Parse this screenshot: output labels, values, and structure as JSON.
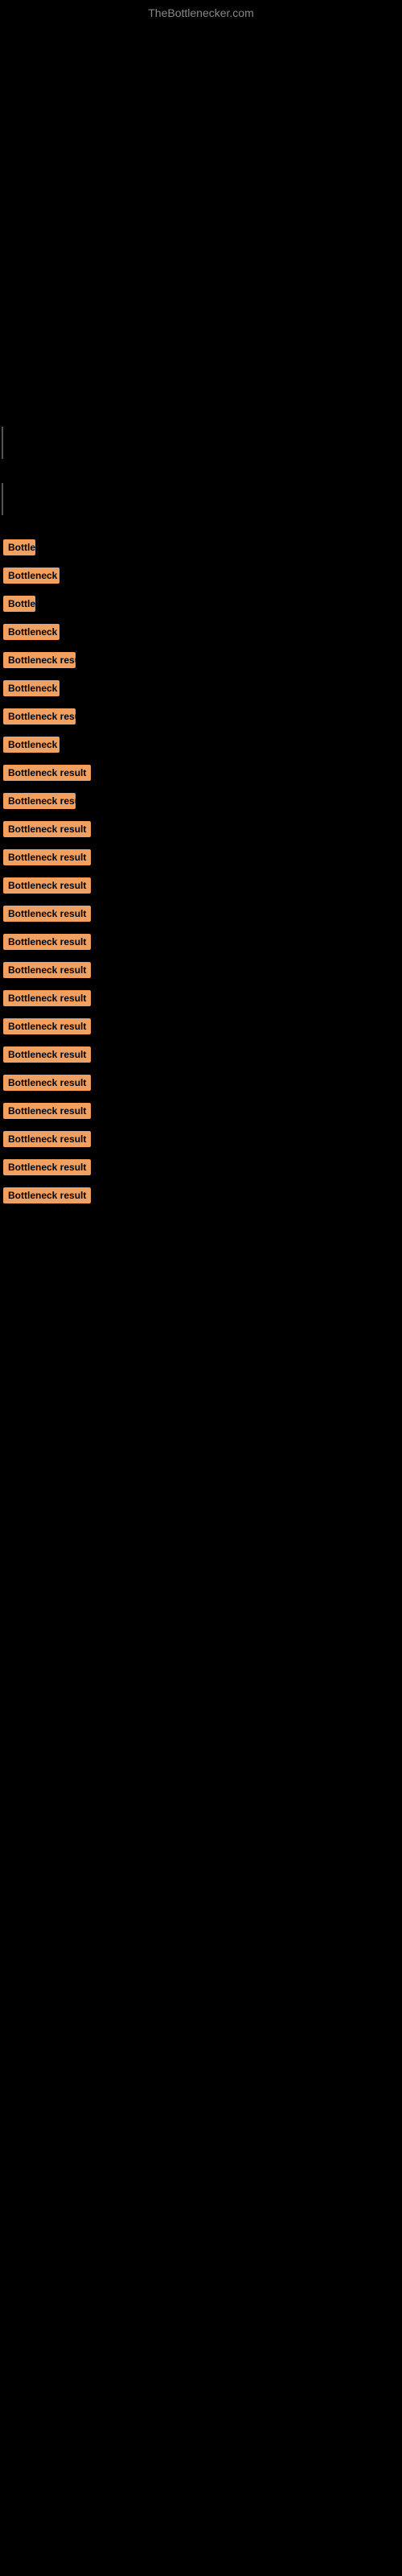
{
  "header": {
    "site_title": "TheBottlenecker.com"
  },
  "bottleneck_items": [
    {
      "id": 1,
      "label": "Bottleneck result",
      "badge_class": "badge-xs"
    },
    {
      "id": 2,
      "label": "Bottleneck result",
      "badge_class": "badge-sm"
    },
    {
      "id": 3,
      "label": "Bottleneck result",
      "badge_class": "badge-xs"
    },
    {
      "id": 4,
      "label": "Bottleneck result",
      "badge_class": "badge-sm"
    },
    {
      "id": 5,
      "label": "Bottleneck result",
      "badge_class": "badge-md"
    },
    {
      "id": 6,
      "label": "Bottleneck result",
      "badge_class": "badge-sm"
    },
    {
      "id": 7,
      "label": "Bottleneck result",
      "badge_class": "badge-md"
    },
    {
      "id": 8,
      "label": "Bottleneck result",
      "badge_class": "badge-sm"
    },
    {
      "id": 9,
      "label": "Bottleneck result",
      "badge_class": "badge-lg"
    },
    {
      "id": 10,
      "label": "Bottleneck result",
      "badge_class": "badge-md"
    },
    {
      "id": 11,
      "label": "Bottleneck result",
      "badge_class": "badge-xl"
    },
    {
      "id": 12,
      "label": "Bottleneck result",
      "badge_class": "badge-xl"
    },
    {
      "id": 13,
      "label": "Bottleneck result",
      "badge_class": "badge-xl"
    },
    {
      "id": 14,
      "label": "Bottleneck result",
      "badge_class": "badge-xl"
    },
    {
      "id": 15,
      "label": "Bottleneck result",
      "badge_class": "badge-xl"
    },
    {
      "id": 16,
      "label": "Bottleneck result",
      "badge_class": "badge-xl"
    },
    {
      "id": 17,
      "label": "Bottleneck result",
      "badge_class": "badge-xl"
    },
    {
      "id": 18,
      "label": "Bottleneck result",
      "badge_class": "badge-xl"
    },
    {
      "id": 19,
      "label": "Bottleneck result",
      "badge_class": "badge-xl"
    },
    {
      "id": 20,
      "label": "Bottleneck result",
      "badge_class": "badge-xl"
    },
    {
      "id": 21,
      "label": "Bottleneck result",
      "badge_class": "badge-xl"
    },
    {
      "id": 22,
      "label": "Bottleneck result",
      "badge_class": "badge-xl"
    },
    {
      "id": 23,
      "label": "Bottleneck result",
      "badge_class": "badge-xl"
    },
    {
      "id": 24,
      "label": "Bottleneck result",
      "badge_class": "badge-xl"
    }
  ]
}
